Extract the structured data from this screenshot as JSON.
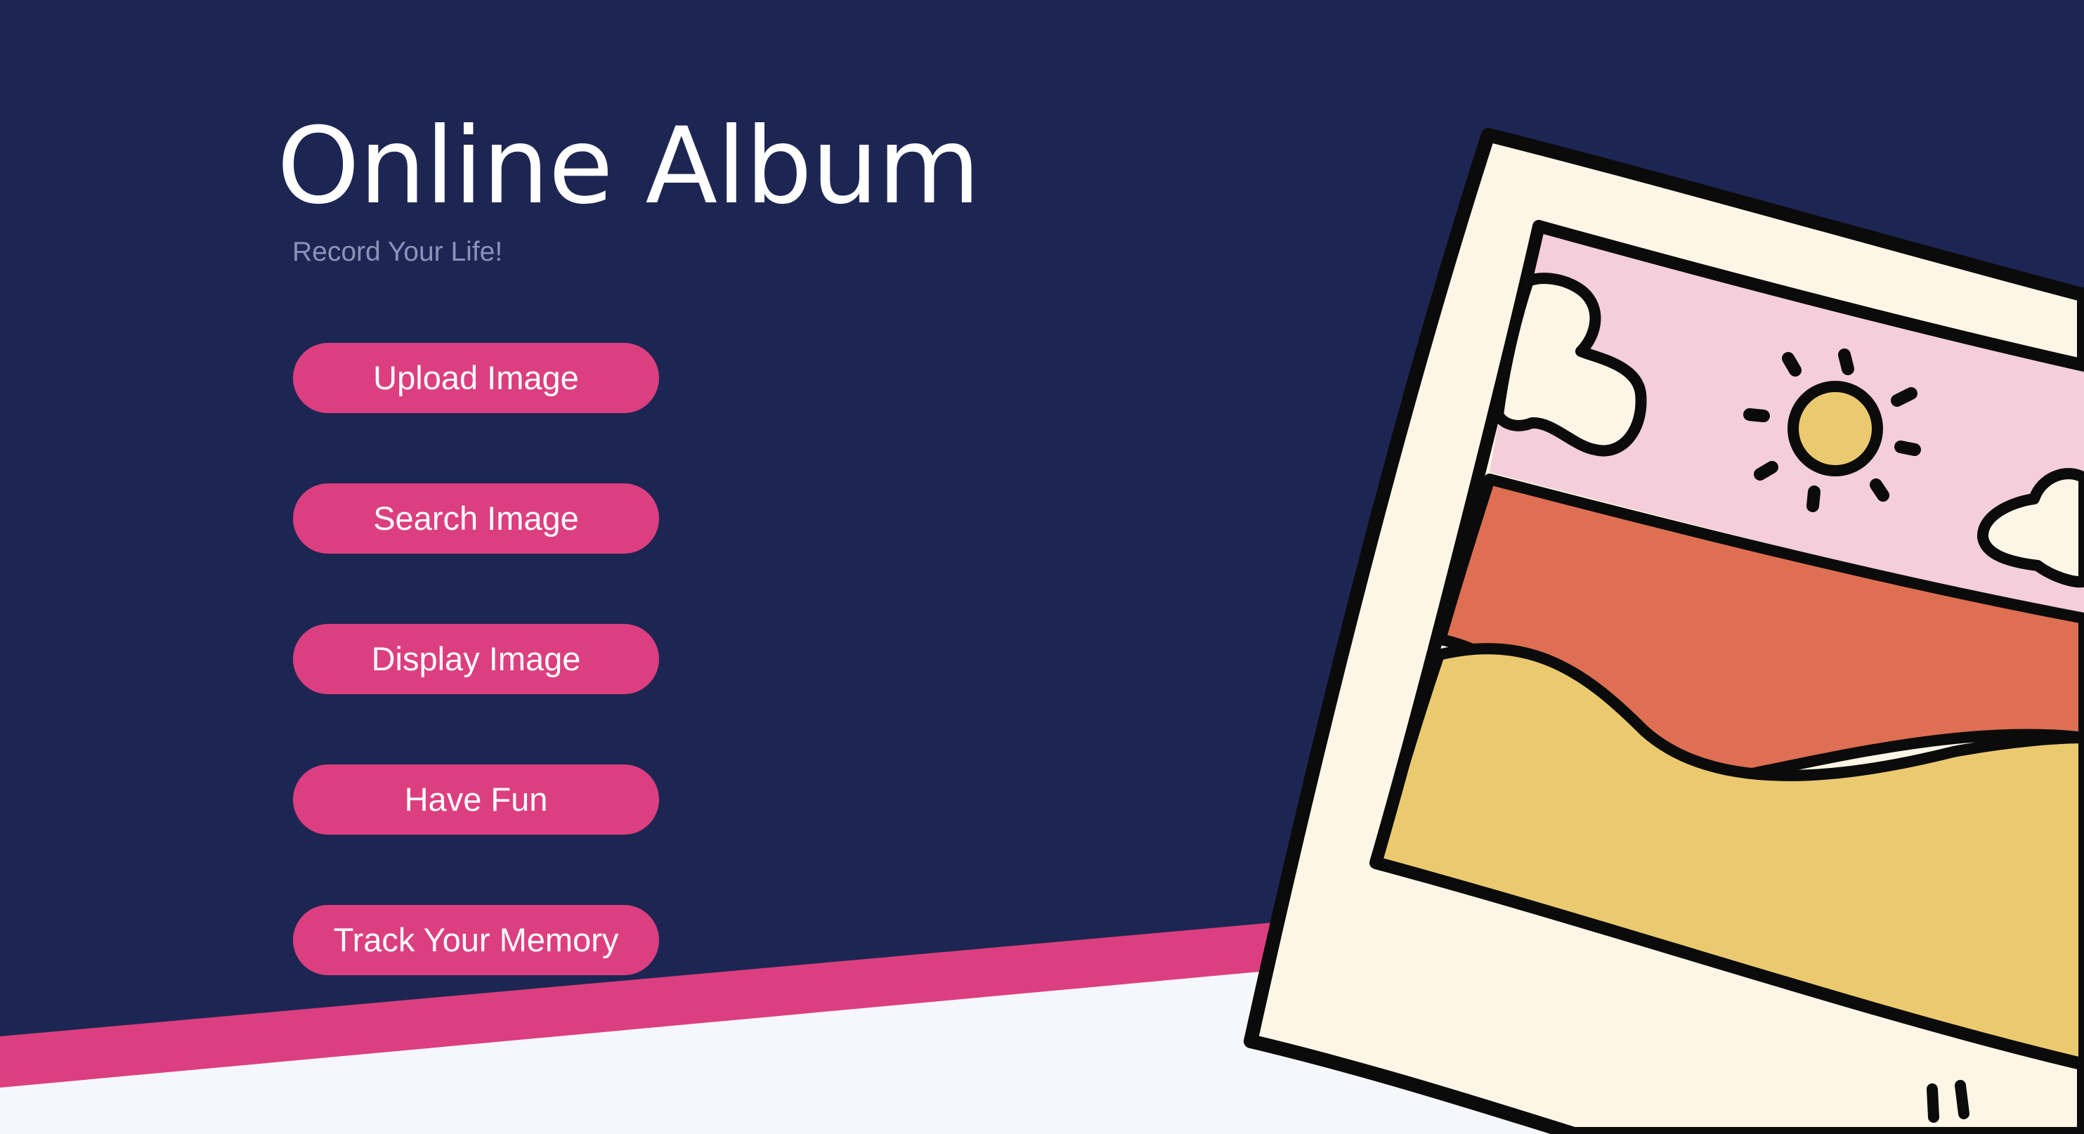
{
  "app": {
    "title": "Online Album",
    "tagline": "Record Your Life!"
  },
  "menu": {
    "items": [
      {
        "label": "Upload Image"
      },
      {
        "label": "Search Image"
      },
      {
        "label": "Display Image"
      },
      {
        "label": "Have Fun"
      },
      {
        "label": "Track Your Memory"
      }
    ]
  },
  "theme": {
    "background": "#1d2653",
    "accent": "#dc3f7f",
    "light_band": "#f6f7fd",
    "photo_frame": "#fdf6e7",
    "sky": "#f4ceda",
    "hill_orange": "#de6f52",
    "hill_yellow": "#ebca6f",
    "sun": "#ebca6f"
  },
  "icons": {
    "illustration": "polaroid-photo-icon"
  }
}
